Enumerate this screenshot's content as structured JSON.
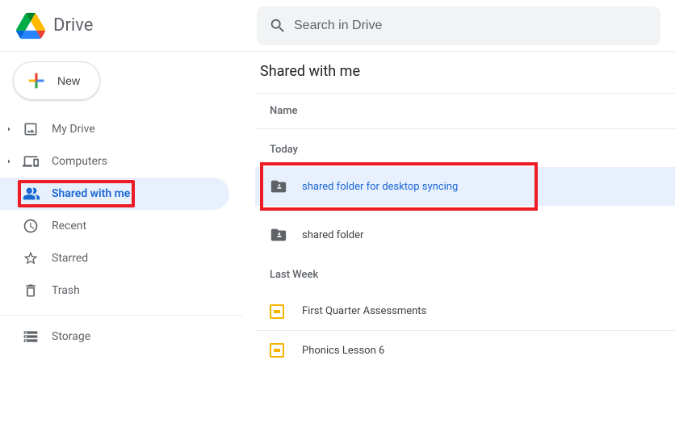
{
  "header": {
    "appName": "Drive",
    "searchPlaceholder": "Search in Drive"
  },
  "sidebar": {
    "newLabel": "New",
    "items": {
      "myDrive": "My Drive",
      "computers": "Computers",
      "sharedWithMe": "Shared with me",
      "recent": "Recent",
      "starred": "Starred",
      "trash": "Trash",
      "storage": "Storage"
    }
  },
  "main": {
    "title": "Shared with me",
    "nameHeader": "Name",
    "sections": {
      "today": "Today",
      "lastWeek": "Last Week"
    },
    "files": {
      "sharedFolderSync": "shared folder for desktop syncing",
      "sharedFolder": "shared folder",
      "firstQuarter": "First Quarter Assessments",
      "phonics": "Phonics Lesson 6"
    }
  }
}
